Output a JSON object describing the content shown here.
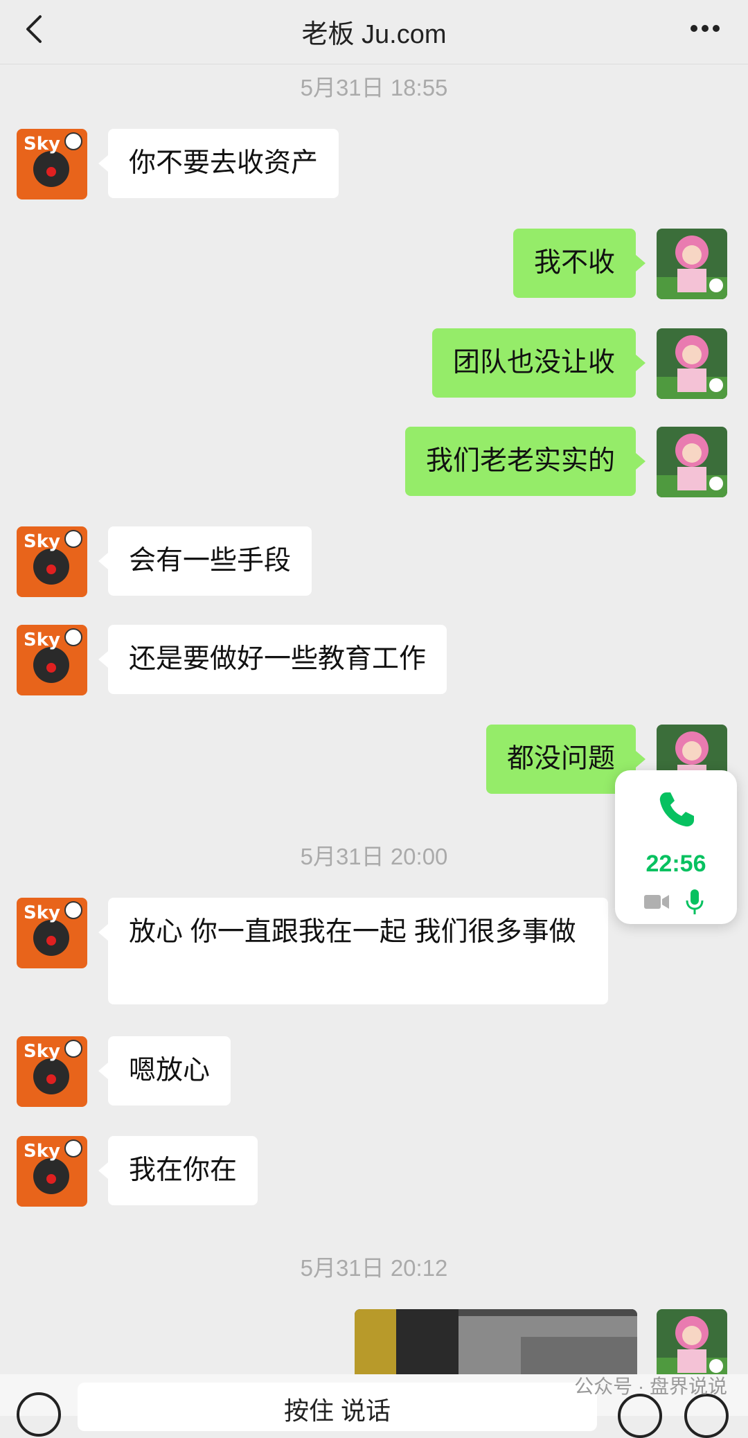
{
  "header": {
    "title": "老板 Ju.com"
  },
  "timestamps": [
    "5月31日 18:55",
    "5月31日 20:00",
    "5月31日 20:12"
  ],
  "messages": [
    {
      "sender": "contact",
      "text": "你不要去收资产"
    },
    {
      "sender": "self",
      "text": "我不收"
    },
    {
      "sender": "self",
      "text": "团队也没让收"
    },
    {
      "sender": "self",
      "text": "我们老老实实的"
    },
    {
      "sender": "contact",
      "text": "会有一些手段"
    },
    {
      "sender": "contact",
      "text": "还是要做好一些教育工作"
    },
    {
      "sender": "self",
      "text": "都没问题"
    },
    {
      "sender": "contact",
      "text": "放心 你一直跟我在一起 我们很多事做"
    },
    {
      "sender": "contact",
      "text": "嗯放心"
    },
    {
      "sender": "contact",
      "text": "我在你在"
    }
  ],
  "call": {
    "duration": "22:56",
    "accent_color": "#07c160"
  },
  "input": {
    "text": "按住 说话"
  },
  "watermark": "公众号 · 盘界说说",
  "colors": {
    "outgoing_bubble": "#95ec69",
    "incoming_bubble": "#ffffff",
    "background": "#ededed"
  }
}
